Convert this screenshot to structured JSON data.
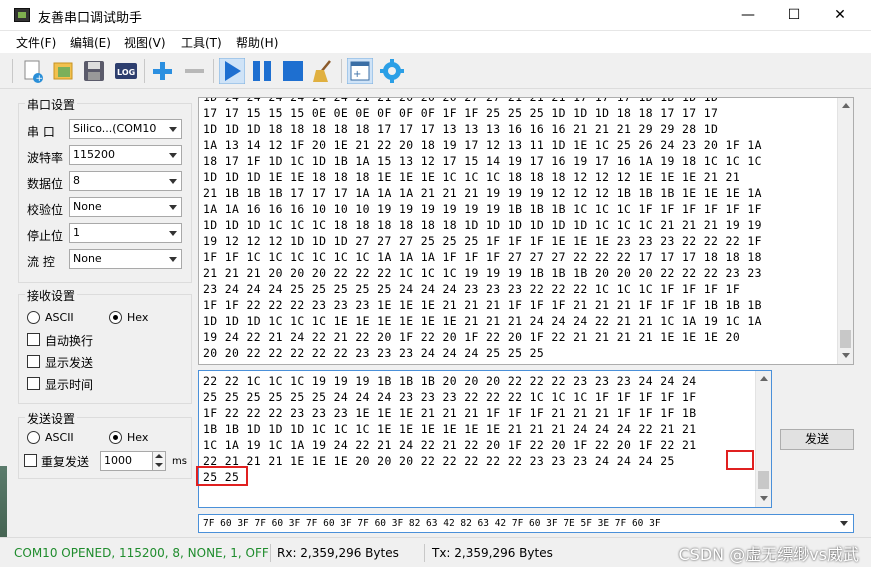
{
  "window": {
    "title": "友善串口调试助手",
    "minimize": "—",
    "maximize": "☐",
    "close": "✕"
  },
  "menu": [
    "文件(F)",
    "编辑(E)",
    "视图(V)",
    "工具(T)",
    "帮助(H)"
  ],
  "toolbar_icons": [
    "new-icon",
    "open-icon",
    "save-icon",
    "log-icon",
    "add-icon",
    "remove-icon",
    "play-icon",
    "pause-icon",
    "stop-icon",
    "clear-icon",
    "window-icon",
    "settings-icon"
  ],
  "serial_settings": {
    "title": "串口设置",
    "port_label": "串 口",
    "port_value": "Silico...(COM10",
    "baud_label": "波特率",
    "baud_value": "115200",
    "databits_label": "数据位",
    "databits_value": "8",
    "parity_label": "校验位",
    "parity_value": "None",
    "stopbits_label": "停止位",
    "stopbits_value": "1",
    "flow_label": "流 控",
    "flow_value": "None"
  },
  "receive_settings": {
    "title": "接收设置",
    "ascii_label": "ASCII",
    "hex_label": "Hex",
    "selected": "Hex",
    "auto_wrap_label": "自动换行",
    "show_send_label": "显示发送",
    "show_time_label": "显示时间"
  },
  "send_settings": {
    "title": "发送设置",
    "ascii_label": "ASCII",
    "hex_label": "Hex",
    "selected": "Hex",
    "repeat_label": "重复发送",
    "interval_value": "1000",
    "interval_unit": "ms"
  },
  "receive_lines": [
    "1D 24 24 24 24 24 24 21 21 20 20 20 27 27 21 21 21 17 17 17 1D 1D 1D 1D",
    "17 17 15 15 15 0E 0E 0E 0F 0F 0F 1F 1F 25 25 25 1D 1D 1D 18 18 17 17 17",
    "1D 1D 1D 18 18 18 18 18 17 17 17 13 13 13 16 16 16 21 21 21 29 29 28 1D",
    "1A 13 14 12 1F 20 1E 21 22 20 18 19 17 12 13 11 1D 1E 1C 25 26 24 23 20 1F 1A",
    "18 17 1F 1D 1C 1D 1B 1A 15 13 12 17 15 14 19 17 16 19 17 16 1A 19 18 1C 1C 1C",
    "1D 1D 1D 1E 1E 18 18 18 1E 1E 1E 1C 1C 1C 18 18 18 12 12 12 1E 1E 1E 21 21",
    "21 1B 1B 1B 17 17 17 1A 1A 1A 21 21 21 19 19 19 12 12 12 1B 1B 1B 1E 1E 1E 1A",
    "1A 1A 16 16 16 10 10 10 19 19 19 19 19 19 1B 1B 1B 1C 1C 1C 1F 1F 1F 1F 1F 1F",
    "1D 1D 1D 1C 1C 1C 18 18 18 18 18 18 1D 1D 1D 1D 1D 1D 1C 1C 1C 21 21 21 19 19",
    "19 12 12 12 1D 1D 1D 27 27 27 25 25 25 1F 1F 1F 1E 1E 1E 23 23 23 22 22 22 1F",
    "1F 1F 1C 1C 1C 1C 1C 1C 1A 1A 1A 1F 1F 1F 27 27 27 22 22 22 17 17 17 18 18 18",
    "21 21 21 20 20 20 22 22 22 1C 1C 1C 19 19 19 1B 1B 1B 20 20 20 22 22 22 23 23",
    "23 24 24 24 25 25 25 25 25 24 24 24 23 23 23 22 22 22 1C 1C 1C 1F 1F 1F 1F",
    "1F 1F 22 22 22 23 23 23 1E 1E 1E 21 21 21 1F 1F 1F 21 21 21 1F 1F 1F 1B 1B 1B",
    "1D 1D 1D 1C 1C 1C 1E 1E 1E 1E 1E 1E 21 21 21 24 24 24 22 21 21 1C 1A 19 1C 1A",
    "19 24 22 21 24 22 21 22 20 1F 22 20 1F 22 20 1F 22 21 21 21 21 1E 1E 1E 20",
    "20 20 22 22 22 22 22 23 23 23 24 24 24 25 25 25"
  ],
  "send_lines": [
    "22 22 1C 1C 1C 19 19 19 1B 1B 1B 20 20 20 22 22 22 23 23 23 24 24 24",
    "25 25 25 25 25 25 24 24 24 23 23 23 22 22 22 1C 1C 1C 1F 1F 1F 1F 1F",
    "1F 22 22 22 23 23 23 1E 1E 1E 21 21 21 1F 1F 1F 21 21 21 1F 1F 1F 1B",
    "1B 1B 1D 1D 1D 1C 1C 1C 1E 1E 1E 1E 1E 1E 21 21 21 24 24 24 22 21 21",
    "1C 1A 19 1C 1A 19 24 22 21 24 22 21 22 20 1F 22 20 1F 22 20 1F 22 21",
    "22 21 21 21 1E 1E 1E 20 20 20 22 22 22 22 22 23 23 23 24 24 24 25",
    "25 25"
  ],
  "send_button": "发送",
  "history_value": "7F 60 3F 7F 60 3F 7F 60 3F 7F 60 3F 82 63 42 82 63 42 7F 60 3F 7E 5F 3E 7F 60 3F",
  "status": {
    "connection": "COM10 OPENED, 115200, 8, NONE, 1, OFF",
    "rx": "Rx: 2,359,296 Bytes",
    "tx": "Tx: 2,359,296 Bytes",
    "watermark": "CSDN @虚无缥缈vs威武"
  },
  "colors": {
    "status_green": "#1f8c2d",
    "highlight_red": "#e02020",
    "focus_blue": "#4a90d9"
  }
}
